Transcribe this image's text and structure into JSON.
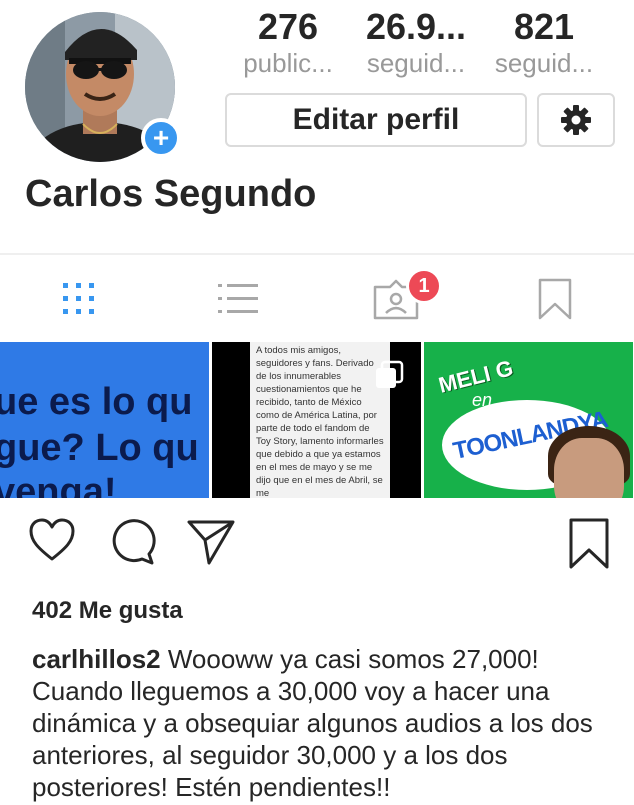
{
  "profile": {
    "name": "Carlos Segundo",
    "add_badge": "+"
  },
  "stats": [
    {
      "num": "276",
      "label": "public..."
    },
    {
      "num": "26.9...",
      "label": "seguid..."
    },
    {
      "num": "821",
      "label": "seguid..."
    }
  ],
  "buttons": {
    "edit_profile": "Editar perfil",
    "settings_icon": "gear-icon"
  },
  "tabs": {
    "items": [
      "grid-icon",
      "list-icon",
      "tagged-icon",
      "saved-icon"
    ],
    "tagged_badge": "1",
    "accent": "#3897f0",
    "badge_color": "#ed4956"
  },
  "thumbnails": {
    "t1_lines": [
      "ue es lo qu",
      "gue? Lo qu",
      "venga!"
    ],
    "t2_text": "A todos mis amigos, seguidores y fans. Derivado de los innumerables cuestionamientos que he recibido, tanto de México como de América Latina, por parte de todo el fandom de Toy Story, lamento informarles que debido a que ya estamos en el mes de mayo y se me dijo que en el mes de Abril, se me",
    "t3_title": "MELI G",
    "t3_en": "en",
    "t3_brand": "TOONLANDYA"
  },
  "post": {
    "likes": "402 Me gusta",
    "username": "carlhillos2",
    "caption": " Woooww ya casi somos 27,000! Cuando lleguemos a 30,000 voy a hacer una dinámica y a obsequiar algunos audios a los dos anteriores, al seguidor 30,000 y a los dos posteriores! Estén pendientes!!"
  }
}
